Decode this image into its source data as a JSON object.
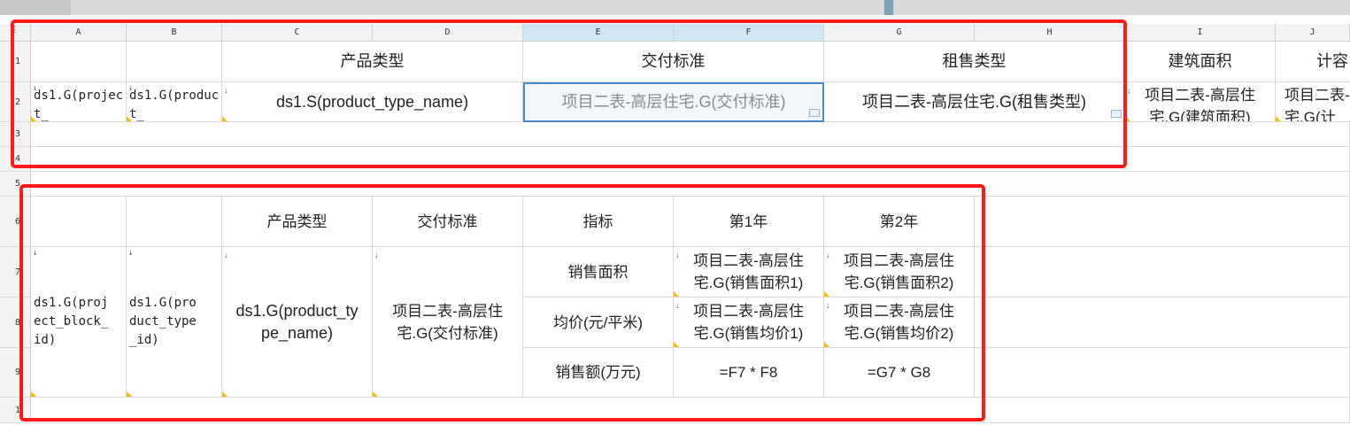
{
  "column_headers": [
    "A",
    "B",
    "C",
    "D",
    "E",
    "F",
    "G",
    "H",
    "I",
    "J"
  ],
  "row_headers": [
    "1",
    "2",
    "3",
    "4",
    "5",
    "6",
    "7",
    "8",
    "9",
    "1"
  ],
  "row1": {
    "product_type": "产品类型",
    "delivery_std": "交付标准",
    "rent_sale_type": "租售类型",
    "building_area": "建筑面积",
    "metric_partial": "计容"
  },
  "row2": {
    "a": "ds1.G(project_",
    "b": "ds1.G(product_",
    "c": "ds1.S(product_type_name)",
    "e": "项目二表-高层住宅.G(交付标准)",
    "g": "项目二表-高层住宅.G(租售类型)",
    "i": "项目二表-高层住宅.G(建筑面积)",
    "j": "项目二表-高层住宅.G(计"
  },
  "table2": {
    "headers": [
      "产品类型",
      "交付标准",
      "指标",
      "第1年",
      "第2年"
    ],
    "a": "ds1.G(project_block_id)",
    "b": "ds1.G(product_type_id)",
    "c": "ds1.G(product_type_name)",
    "d": "项目二表-高层住宅.G(交付标准)",
    "indicators": [
      "销售面积",
      "均价(元/平米)",
      "销售额(万元)"
    ],
    "year1": [
      "项目二表-高层住宅.G(销售面积1)",
      "项目二表-高层住宅.G(销售均价1)",
      "=F7 * F8"
    ],
    "year2": [
      "项目二表-高层住宅.G(销售面积2)",
      "项目二表-高层住宅.G(销售均价2)",
      "=G7 * G8"
    ]
  }
}
